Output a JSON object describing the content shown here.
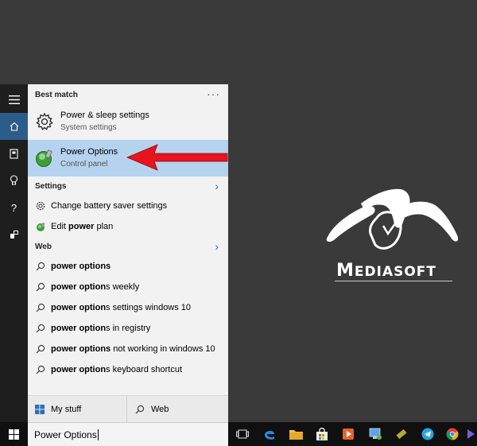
{
  "best_match": {
    "header": "Best match",
    "more": "···",
    "items": [
      {
        "title": "Power & sleep settings",
        "subtitle": "System settings",
        "icon": "gear-icon"
      },
      {
        "title": "Power Options",
        "subtitle": "Control panel",
        "icon": "power-options-icon"
      }
    ]
  },
  "settings": {
    "header": "Settings",
    "items": [
      {
        "pre": "Change battery saver settings",
        "bold": "",
        "post": ""
      },
      {
        "pre": "Edit ",
        "bold": "power",
        "post": " plan"
      }
    ]
  },
  "web": {
    "header": "Web",
    "items": [
      {
        "bold": "power options",
        "post": ""
      },
      {
        "bold": "power option",
        "post": "s weekly"
      },
      {
        "bold": "power option",
        "post": "s settings windows 10"
      },
      {
        "bold": "power option",
        "post": "s in registry"
      },
      {
        "bold": "power options",
        "post": " not working in windows 10"
      },
      {
        "bold": "power option",
        "post": "s keyboard shortcut"
      }
    ]
  },
  "bottom_tabs": {
    "my_stuff": "My stuff",
    "web": "Web"
  },
  "search": {
    "value": "Power Options"
  },
  "logo": {
    "text_big": "M",
    "text_rest": "EDIASOFT"
  },
  "colors": {
    "accent": "#2c5c8a",
    "selected": "#b5d3ee",
    "arrow": "#e8141b"
  }
}
